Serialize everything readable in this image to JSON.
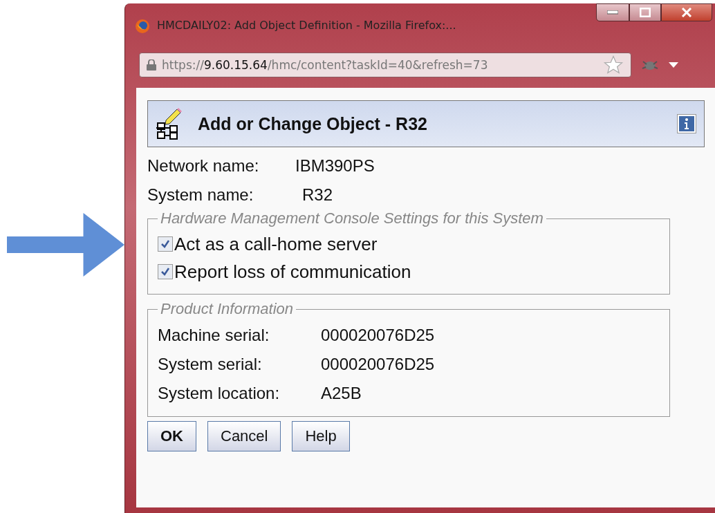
{
  "window": {
    "title": "HMCDAILY02: Add Object Definition - Mozilla Firefox:..."
  },
  "address_bar": {
    "scheme": "https://",
    "host": "9.60.15.64",
    "path": "/hmc/content?taskId=40&refresh=73"
  },
  "dialog": {
    "title": "Add or Change Object - R32",
    "fields": [
      {
        "label": "Network name:",
        "value": "IBM390PS"
      },
      {
        "label": "System name:",
        "value": "R32"
      }
    ],
    "settings": {
      "legend": "Hardware Management Console Settings for this System",
      "options": [
        {
          "label": "Act as a call-home server",
          "checked": true
        },
        {
          "label": "Report loss of communication",
          "checked": true
        }
      ]
    },
    "product_info": {
      "legend": "Product Information",
      "rows": [
        {
          "label": "Machine serial:",
          "value": "000020076D25"
        },
        {
          "label": "System serial:",
          "value": "000020076D25"
        },
        {
          "label": "System location:",
          "value": "A25B"
        }
      ]
    },
    "buttons": [
      {
        "label": "OK",
        "default": true
      },
      {
        "label": "Cancel",
        "default": false
      },
      {
        "label": "Help",
        "default": false
      }
    ]
  }
}
